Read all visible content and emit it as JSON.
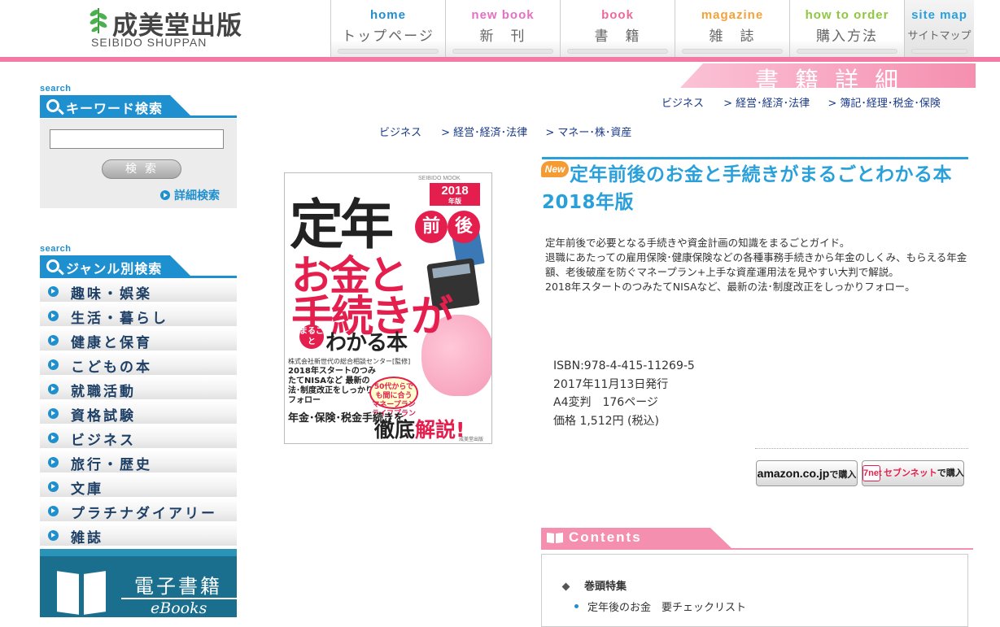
{
  "header": {
    "logo_ja": "成美堂出版",
    "logo_en": "SEIBIDO SHUPPAN",
    "nav": [
      {
        "en": "home",
        "ja": "トップページ",
        "color": "#1e8fcf"
      },
      {
        "en": "new book",
        "ja": "新　刊",
        "color": "#e56fc1"
      },
      {
        "en": "book",
        "ja": "書　籍",
        "color": "#f0689a"
      },
      {
        "en": "magazine",
        "ja": "雑　誌",
        "color": "#f5a13a"
      },
      {
        "en": "how to order",
        "ja": "購入方法",
        "color": "#8fc73e"
      },
      {
        "en": "site map",
        "ja": "サイトマップ",
        "color": "#29a0da"
      }
    ],
    "accent_pink": "#f27aa5"
  },
  "section_banner": "書籍詳細",
  "sidebar": {
    "keyword": {
      "small": "search",
      "title": "キーワード検索",
      "input_value": "",
      "button": "検索",
      "detail_link": "詳細検索"
    },
    "genre": {
      "small": "search",
      "title": "ジャンル別検索",
      "items": [
        "趣味・娯楽",
        "生活・暮らし",
        "健康と保育",
        "こどもの本",
        "就職活動",
        "資格試験",
        "ビジネス",
        "旅行・歴史",
        "文庫",
        "プラチナダイアリー",
        "雑誌"
      ]
    },
    "ebooks": {
      "ja": "電子書籍",
      "en": "eBooks"
    },
    "accent_blue": "#1e8fcf"
  },
  "breadcrumb1": {
    "a": "ビジネス",
    "b": "> 経営･経済･法律",
    "c": "> 簿記･経理･税金･保険"
  },
  "breadcrumb2": {
    "a": "ビジネス",
    "b": "> 経営･経済･法律",
    "c": "> マネー･株･資産"
  },
  "cover": {
    "series": "SEIBIDO MOOK",
    "year": "2018",
    "year_suffix": "年版",
    "t1": "定年",
    "t2a": "前",
    "t2b": "後",
    "t3": "お金と",
    "t4": "手続きが",
    "maru": "まるごと",
    "t5": "わかる本",
    "small": "株式会社新世代の総合相談センター[監修]",
    "lines": "2018年スタートのつみたてNISAなど 最新の法･制度改正をしっかりフォロー",
    "bubble": "50代からでも間に合う マネープラン ライフプラン",
    "bottom1": "年金･保険･税金手続きを",
    "bottom2a": "徹底",
    "bottom2b": "解説!",
    "publisher": "成美堂出版"
  },
  "book": {
    "badge": "New",
    "title": "定年前後のお金と手続きがまるごとわかる本　2018年版",
    "description": [
      "定年前後で必要となる手続きや資金計画の知識をまるごとガイド。",
      "退職にあたっての雇用保険･健康保険などの各種事務手続きから年金のしくみ、もらえる年金額、老後破産を防ぐマネープラン+上手な資産運用法を見やすい大判で解説。",
      "2018年スタートのつみたてNISAなど、最新の法･制度改正をしっかりフォロー。"
    ],
    "isbn": "ISBN:978-4-415-11269-5",
    "date": "2017年11月13日発行",
    "format": "A4変判　176ページ",
    "price": "価格 1,512円 (税込)",
    "title_color": "#29a0da"
  },
  "buy": {
    "amazon_brand": "amazon.co.jp",
    "amazon_label": "で購入",
    "seven_brand": "7net",
    "seven_name": "セブンネット",
    "seven_label": "で購入"
  },
  "contents": {
    "title": "Contents",
    "section": "巻頭特集",
    "items": [
      "定年後のお金　要チェックリスト"
    ]
  }
}
